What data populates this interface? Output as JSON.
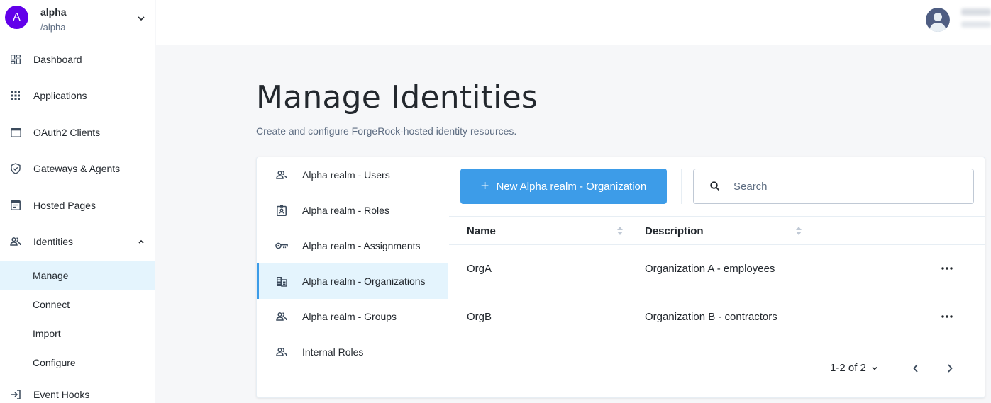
{
  "realm": {
    "initial": "A",
    "name": "alpha",
    "path": "/alpha",
    "avatar_color": "#6200ea"
  },
  "sidebar": {
    "items": [
      {
        "label": "Dashboard",
        "icon": "dashboard-icon"
      },
      {
        "label": "Applications",
        "icon": "apps-grid-icon"
      },
      {
        "label": "OAuth2 Clients",
        "icon": "window-icon"
      },
      {
        "label": "Gateways & Agents",
        "icon": "shield-check-icon"
      },
      {
        "label": "Hosted Pages",
        "icon": "web-page-icon"
      },
      {
        "label": "Identities",
        "icon": "people-icon",
        "expanded": true
      }
    ],
    "identities_sub": [
      {
        "label": "Manage",
        "active": true
      },
      {
        "label": "Connect"
      },
      {
        "label": "Import"
      },
      {
        "label": "Configure"
      }
    ],
    "event_hooks": {
      "label": "Event Hooks",
      "icon": "login-arrow-icon"
    }
  },
  "page": {
    "title": "Manage Identities",
    "subtitle": "Create and configure ForgeRock-hosted identity resources."
  },
  "tabs": [
    {
      "label": "Alpha realm - Users",
      "icon": "people-icon"
    },
    {
      "label": "Alpha realm - Roles",
      "icon": "badge-icon"
    },
    {
      "label": "Alpha realm - Assignments",
      "icon": "key-icon"
    },
    {
      "label": "Alpha realm - Organizations",
      "icon": "building-icon",
      "active": true
    },
    {
      "label": "Alpha realm - Groups",
      "icon": "people-icon"
    },
    {
      "label": "Internal Roles",
      "icon": "people-icon"
    }
  ],
  "toolbar": {
    "new_button_label": "New Alpha realm - Organization",
    "search_placeholder": "Search",
    "search_value": ""
  },
  "table": {
    "columns": [
      "Name",
      "Description"
    ],
    "rows": [
      {
        "name": "OrgA",
        "description": "Organization A - employees"
      },
      {
        "name": "OrgB",
        "description": "Organization B - contractors"
      }
    ]
  },
  "pagination": {
    "range_text": "1-2 of 2"
  },
  "colors": {
    "accent": "#3d9ce8",
    "active_bg": "#e4f4fd",
    "text": "#23282e",
    "muted": "#5e6d82"
  }
}
